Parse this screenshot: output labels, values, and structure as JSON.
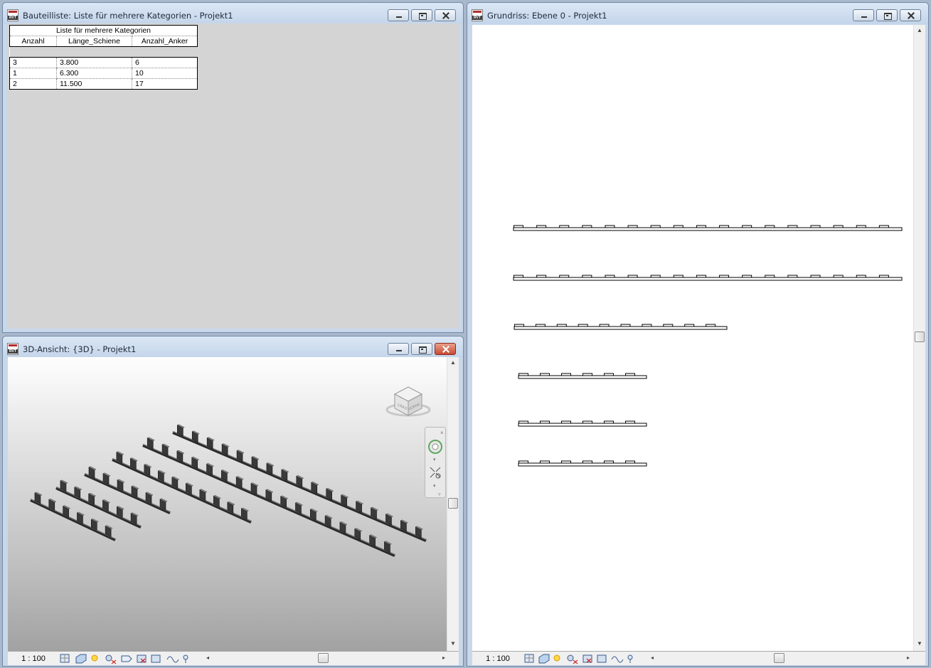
{
  "schedule_window": {
    "title": "Bauteilliste: Liste für mehrere Kategorien - Projekt1",
    "icon": "rvt-document-icon",
    "schedule": {
      "title": "Liste für mehrere Kategorien",
      "columns": [
        "Anzahl",
        "Länge_Schiene",
        "Anzahl_Anker"
      ],
      "rows": [
        [
          "3",
          "3.800",
          "6"
        ],
        [
          "1",
          "6.300",
          "10"
        ],
        [
          "2",
          "11.500",
          "17"
        ]
      ]
    }
  },
  "view3d_window": {
    "title": "3D-Ansicht: {3D} - Projekt1",
    "icon": "rvt-document-icon",
    "scale": "1 : 100",
    "viewcube": {
      "face_left": "LINKS",
      "face_right": "VORNE"
    }
  },
  "plan_window": {
    "title": "Grundriss: Ebene 0 - Projekt1",
    "icon": "rvt-document-icon",
    "scale": "1 : 100"
  },
  "colors": {
    "titlebar_bg": "#c9d7e9",
    "close_active": "#c84b35",
    "schedule_bg": "#d4d4d4",
    "rail_fill": "#2a2a2a"
  }
}
